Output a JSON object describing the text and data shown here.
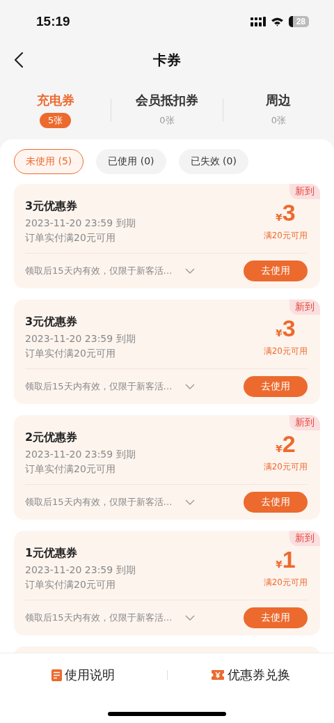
{
  "status_bar": {
    "time": "15:19",
    "battery": "28"
  },
  "nav": {
    "title": "卡券"
  },
  "category_tabs": [
    {
      "label": "充电券",
      "count": "5张",
      "selected": true
    },
    {
      "label": "会员抵扣券",
      "count": "0张",
      "selected": false
    },
    {
      "label": "周边",
      "count": "0张",
      "selected": false
    }
  ],
  "filters": [
    {
      "label": "未使用 (5)",
      "selected": true
    },
    {
      "label": "已使用 (0)",
      "selected": false
    },
    {
      "label": "已失效 (0)",
      "selected": false
    }
  ],
  "coupons": [
    {
      "title": "3元优惠券",
      "expiry": "2023-11-20 23:59 到期",
      "condition": "订单实付满20元可用",
      "currency": "¥",
      "amount": "3",
      "threshold": "满20元可用",
      "tag": "新到",
      "note": "领取后15天内有效，仅限于新客活…",
      "action": "去使用"
    },
    {
      "title": "3元优惠券",
      "expiry": "2023-11-20 23:59 到期",
      "condition": "订单实付满20元可用",
      "currency": "¥",
      "amount": "3",
      "threshold": "满20元可用",
      "tag": "新到",
      "note": "领取后15天内有效，仅限于新客活…",
      "action": "去使用"
    },
    {
      "title": "2元优惠券",
      "expiry": "2023-11-20 23:59 到期",
      "condition": "订单实付满20元可用",
      "currency": "¥",
      "amount": "2",
      "threshold": "满20元可用",
      "tag": "新到",
      "note": "领取后15天内有效，仅限于新客活…",
      "action": "去使用"
    },
    {
      "title": "1元优惠券",
      "expiry": "2023-11-20 23:59 到期",
      "condition": "订单实付满20元可用",
      "currency": "¥",
      "amount": "1",
      "threshold": "满20元可用",
      "tag": "新到",
      "note": "领取后15天内有效，仅限于新客活…",
      "action": "去使用"
    }
  ],
  "bottom_bar": [
    {
      "label": "使用说明",
      "kind": "doc"
    },
    {
      "label": "优惠券兑换",
      "kind": "ticket"
    }
  ]
}
